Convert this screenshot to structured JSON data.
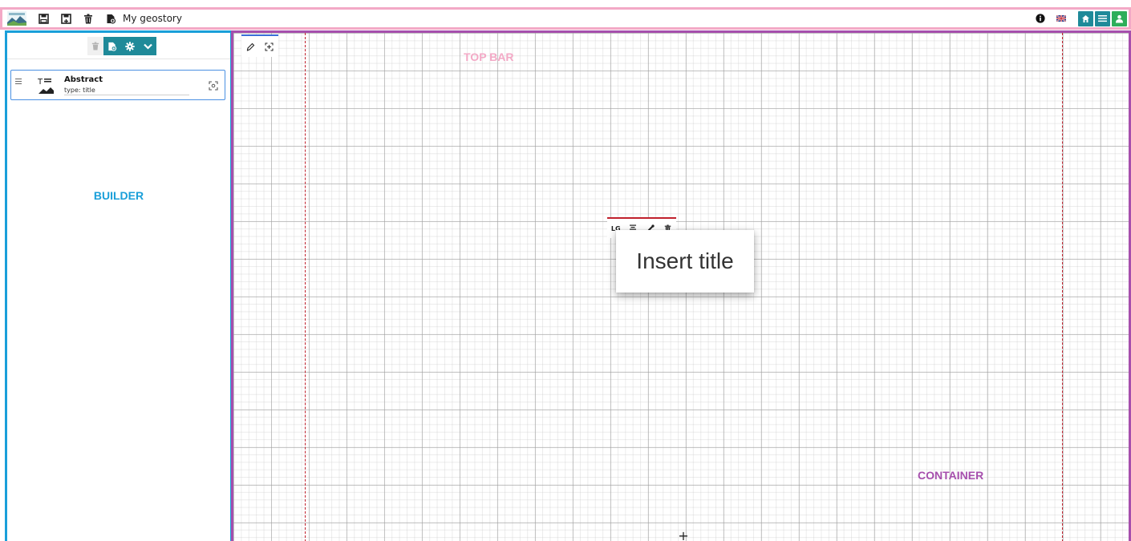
{
  "app": {
    "story_name": "My geostory"
  },
  "labels": {
    "topbar": "TOP BAR",
    "builder": "BUILDER",
    "container": "CONTAINER"
  },
  "topbar": {
    "left_icons": [
      "save-icon",
      "save-as-icon",
      "trash-icon",
      "story-file-icon"
    ],
    "right_icons": [
      "info-icon",
      "language-flag-icon",
      "home-icon",
      "menu-icon",
      "user-icon"
    ],
    "colors": {
      "home": "#1f8a99",
      "menu": "#1f8a99",
      "user": "#2dae5a"
    }
  },
  "builder": {
    "toolbar_icons": [
      "trash-icon",
      "add-section-icon",
      "settings-icon",
      "chevron-down-icon"
    ],
    "cards": [
      {
        "title": "Abstract",
        "type_value": "type: title"
      }
    ]
  },
  "container": {
    "tools": [
      "pencil-icon",
      "expand-icon"
    ],
    "title_toolbar": {
      "size": "LG",
      "icons": [
        "align-icon",
        "color-picker-icon",
        "trash-icon"
      ]
    },
    "title_text": "Insert title",
    "add_label": "+"
  },
  "colors": {
    "topbar_border": "#f3a9c6",
    "builder_border": "#1a9fd9",
    "container_border": "#a64fad",
    "accent_teal": "#1f8a99",
    "guide_red": "#c0202c"
  }
}
